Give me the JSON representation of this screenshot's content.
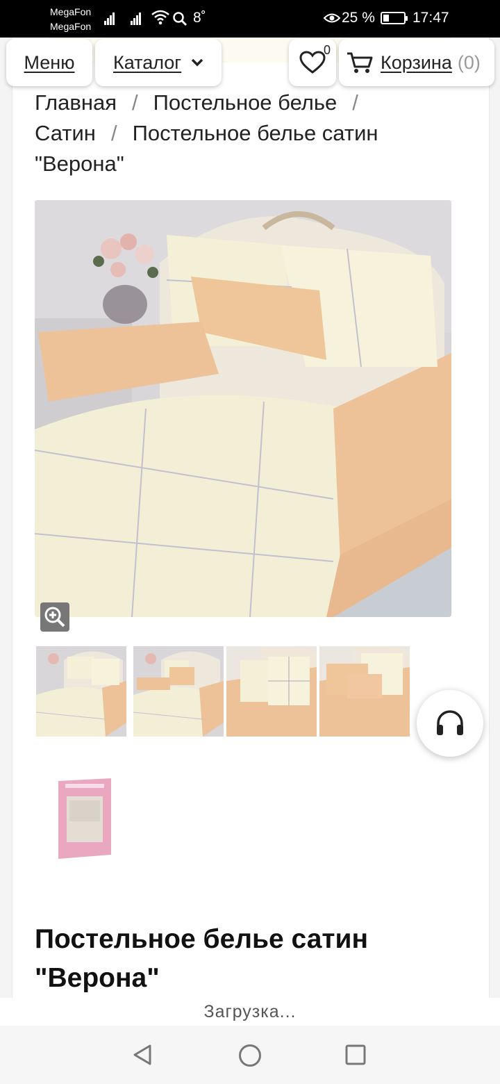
{
  "status_bar": {
    "carrier1": "MegaFon",
    "carrier2": "MegaFon",
    "temperature": "8˚",
    "battery": "25 %",
    "time": "17:47"
  },
  "header": {
    "menu_label": "Меню",
    "catalog_label": "Каталог",
    "favorites_count": "0",
    "cart_label": "Корзина",
    "cart_count": "(0)"
  },
  "breadcrumb": {
    "items": [
      "Главная",
      "Постельное белье",
      "Сатин",
      "Постельное белье сатин \"Верона\""
    ],
    "separator": "/"
  },
  "gallery": {
    "thumbnails": 5
  },
  "product": {
    "title": "Постельное белье сатин \"Верона\""
  },
  "loading_text": "Загрузка...",
  "colors": {
    "cream": "#f3efd6",
    "peach": "#edc298",
    "accent_text": "#222222"
  },
  "icons": [
    "signal-icon",
    "wifi-icon",
    "search-icon",
    "eye-icon",
    "battery-icon",
    "heart-icon",
    "cart-icon",
    "chevron-down-icon",
    "zoom-icon",
    "headset-icon",
    "back-icon",
    "home-icon",
    "recents-icon"
  ]
}
